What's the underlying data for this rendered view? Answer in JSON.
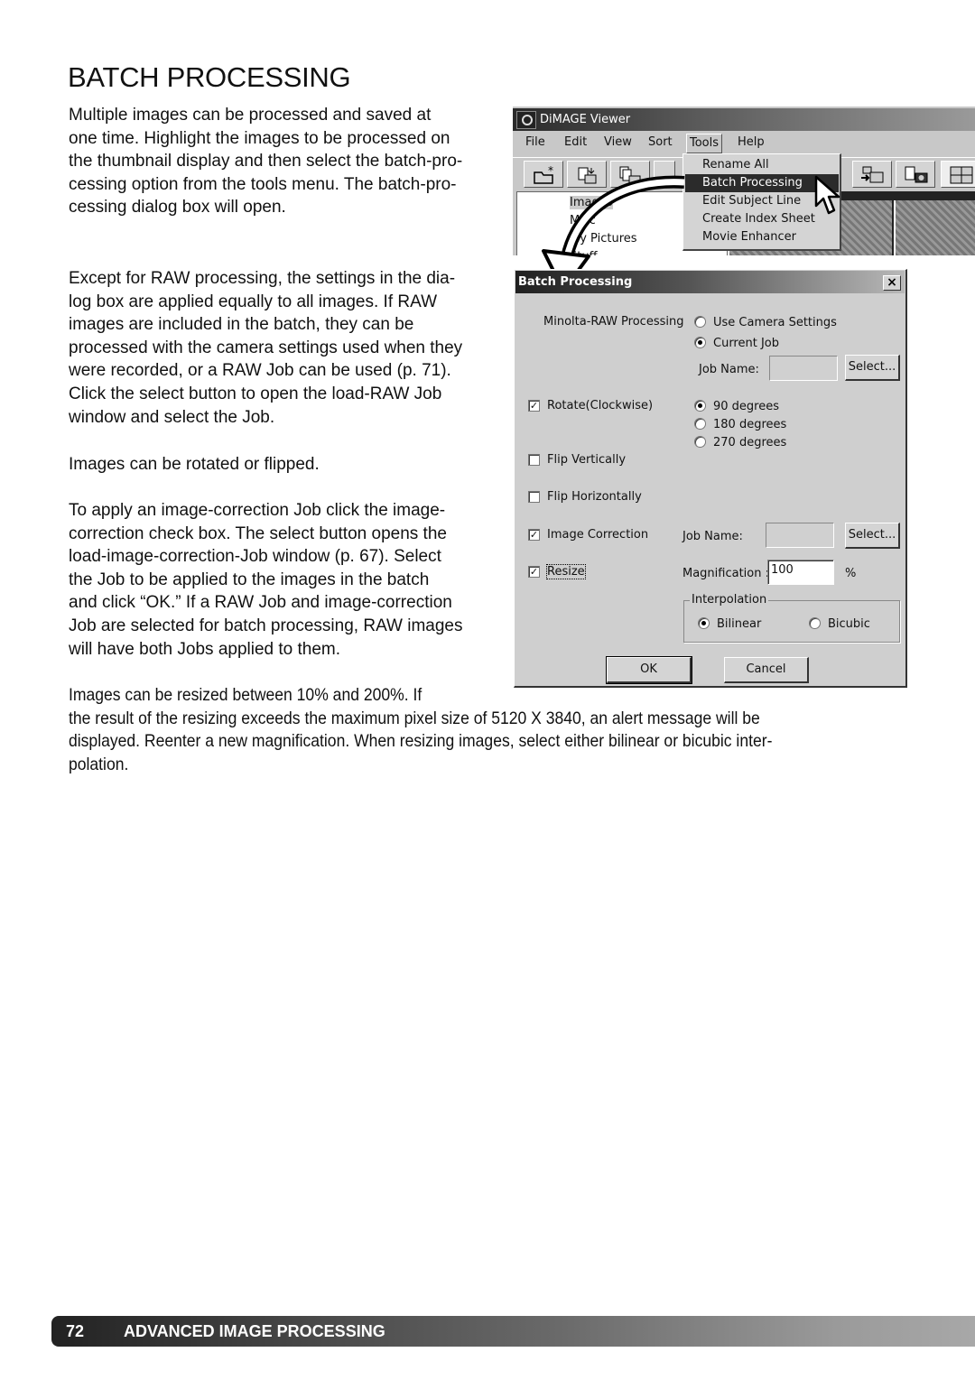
{
  "page": {
    "title": "BATCH PROCESSING",
    "paragraphs": [
      "Multiple images can be processed and saved at\none time. Highlight the images to be processed on\nthe thumbnail display and then select the batch-pro-\ncessing option from the tools menu. The batch-pro-\ncessing dialog box will open.",
      "Except for RAW processing, the settings in the dia-\nlog box are applied equally to all images. If RAW\nimages are included in the batch, they can be\nprocessed with the camera settings used when they\nwere recorded, or a RAW Job can be used (p. 71).\nClick the select button to open the load-RAW Job\nwindow and select the Job.",
      "Images can be rotated or flipped.",
      "To apply an image-correction Job click the image-\ncorrection check box. The select button opens the\nload-image-correction-Job window (p. 67). Select\nthe Job to be applied to the images in the batch\nand click “OK.” If a RAW Job and image-correction\nJob are selected for batch processing, RAW images\nwill have both Jobs applied to them.",
      "Images can be resized between 10% and 200%. If\nthe result of the resizing exceeds the maximum pixel size of 5120 X 3840, an alert message will be\ndisplayed. Reenter a new magnification. When resizing images, select either bilinear or bicubic inter-\npolation."
    ],
    "footer": {
      "page_number": "72",
      "section": "ADVANCED IMAGE PROCESSING"
    }
  },
  "viewer": {
    "title": "DiMAGE Viewer",
    "menus": [
      "File",
      "Edit",
      "View",
      "Sort",
      "Tools",
      "Help"
    ],
    "active_menu": "Tools",
    "tree_items": [
      "Images",
      "Misc",
      "My Pictures",
      "Stuff"
    ],
    "tools_menu": [
      "Rename All",
      "Batch Processing",
      "Edit Subject Line",
      "Create Index Sheet",
      "Movie Enhancer"
    ],
    "selected_menu_item": "Batch Processing"
  },
  "dialog": {
    "title": "Batch Processing",
    "close_label": "×",
    "raw": {
      "label": "Minolta-RAW Processing",
      "options": [
        "Use Camera Settings",
        "Current Job"
      ],
      "selected": "Current Job",
      "job_name_label": "Job Name:",
      "job_name_value": "",
      "select_label": "Select..."
    },
    "rotate": {
      "label": "Rotate(Clockwise)",
      "checked": true,
      "options": [
        "90 degrees",
        "180 degrees",
        "270 degrees"
      ],
      "selected": "90 degrees"
    },
    "flip_vertical": {
      "label": "Flip Vertically",
      "checked": false
    },
    "flip_horizontal": {
      "label": "Flip Horizontally",
      "checked": false
    },
    "image_correction": {
      "label": "Image Correction",
      "checked": true,
      "job_name_label": "Job Name:",
      "job_name_value": "",
      "select_label": "Select..."
    },
    "resize": {
      "label": "Resize",
      "checked": true,
      "magnification_label": "Magnification :",
      "magnification_value": "100",
      "unit": "%"
    },
    "interpolation": {
      "label": "Interpolation",
      "options": [
        "Bilinear",
        "Bicubic"
      ],
      "selected": "Bilinear"
    },
    "ok_label": "OK",
    "cancel_label": "Cancel"
  }
}
